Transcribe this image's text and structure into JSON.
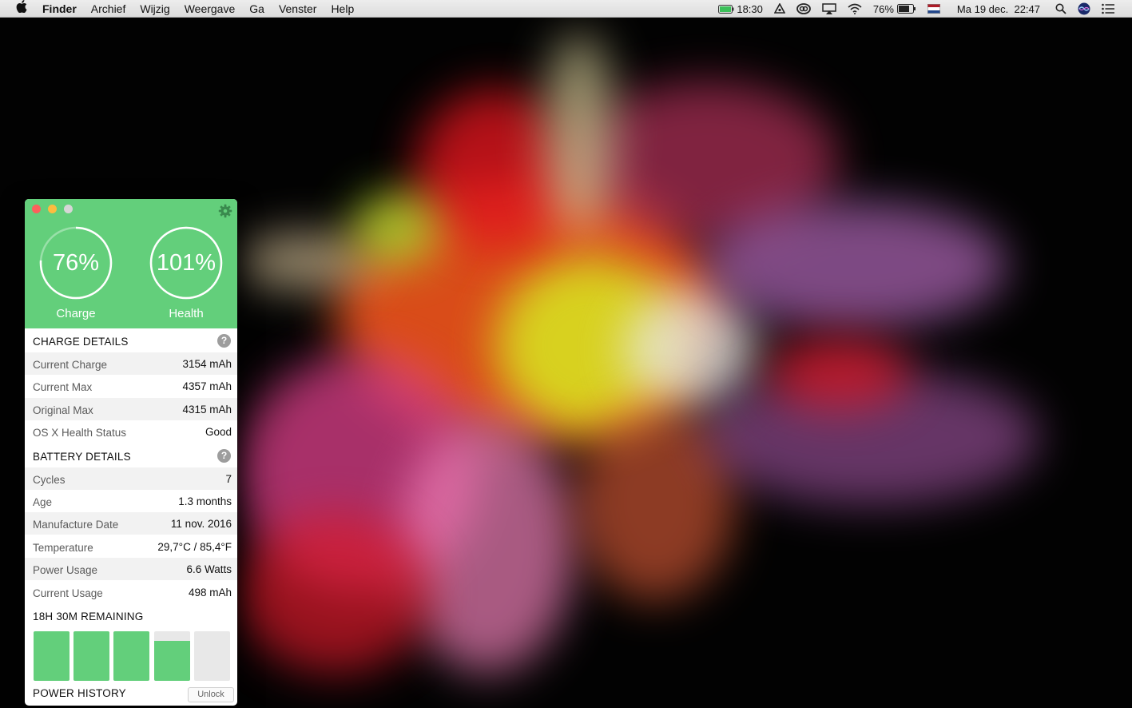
{
  "menubar": {
    "app_name": "Finder",
    "menus": [
      "Archief",
      "Wijzig",
      "Weergave",
      "Ga",
      "Venster",
      "Help"
    ],
    "battery_time": "18:30",
    "battery_percent": "76%",
    "datetime": "Ma 19 dec.  22:47"
  },
  "widget": {
    "charge": {
      "value": "76%",
      "label": "Charge",
      "fraction": 0.76
    },
    "health": {
      "value": "101%",
      "label": "Health",
      "fraction": 1.0
    },
    "charge_details": {
      "title": "CHARGE DETAILS",
      "help": "?",
      "rows": [
        {
          "label": "Current Charge",
          "value": "3154 mAh"
        },
        {
          "label": "Current Max",
          "value": "4357 mAh"
        },
        {
          "label": "Original Max",
          "value": "4315 mAh"
        },
        {
          "label": "OS X Health Status",
          "value": "Good"
        }
      ]
    },
    "battery_details": {
      "title": "BATTERY DETAILS",
      "help": "?",
      "rows": [
        {
          "label": "Cycles",
          "value": "7"
        },
        {
          "label": "Age",
          "value": "1.3 months"
        },
        {
          "label": "Manufacture Date",
          "value": "11 nov. 2016"
        },
        {
          "label": "Temperature",
          "value": "29,7°C / 85,4°F"
        },
        {
          "label": "Power Usage",
          "value": "6.6 Watts"
        },
        {
          "label": "Current Usage",
          "value": "498 mAh"
        }
      ]
    },
    "remaining": {
      "title": "18H 30M REMAINING",
      "bar_levels": [
        1,
        1,
        1,
        0.8,
        0
      ]
    },
    "power_history": {
      "title": "POWER HISTORY",
      "unlock_label": "Unlock"
    },
    "accent_color": "#63cf7b"
  }
}
